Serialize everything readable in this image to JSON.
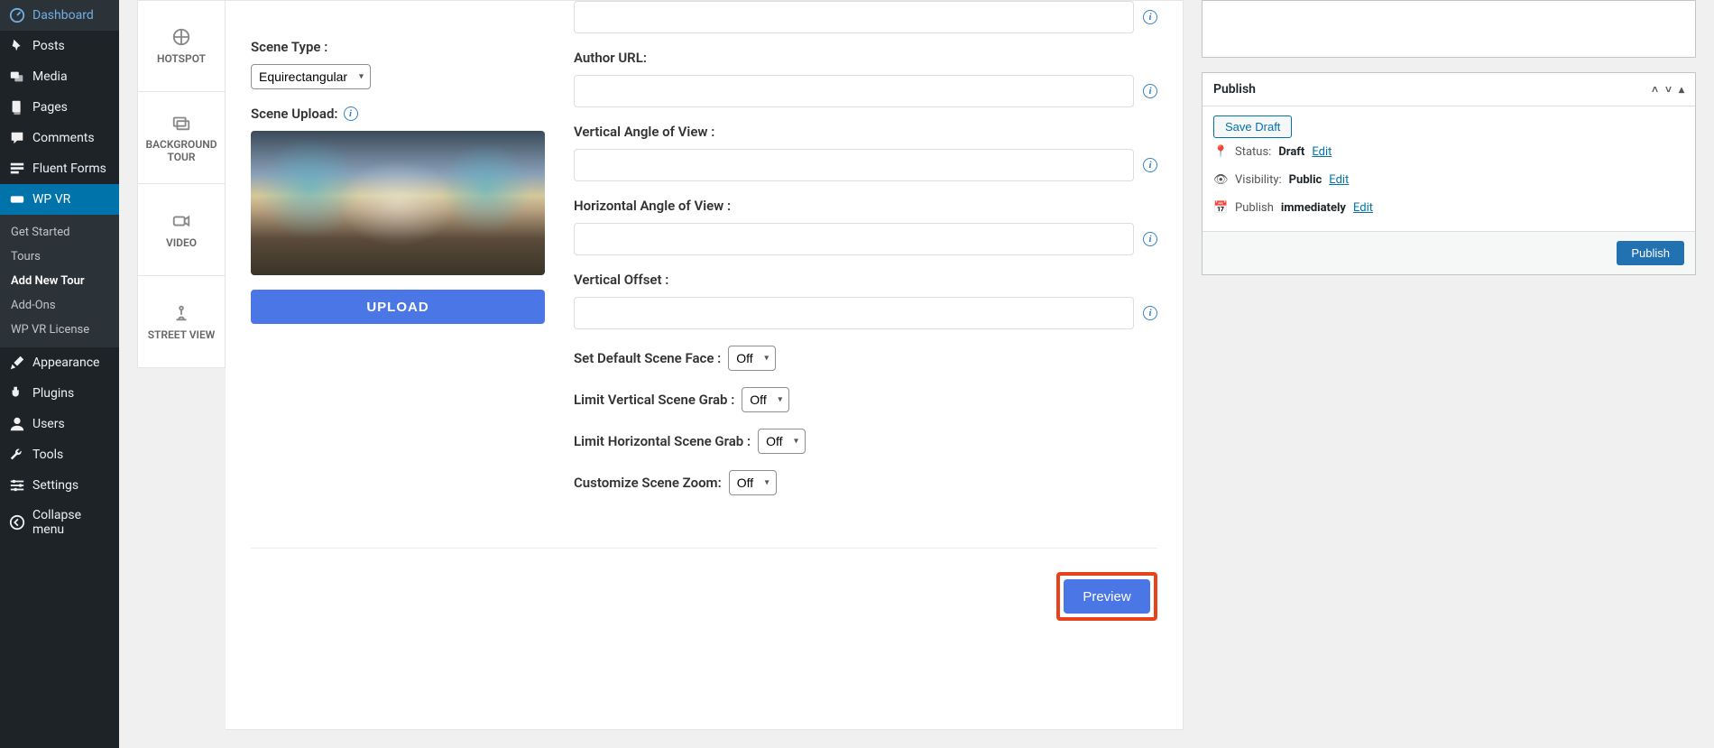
{
  "sidebar": {
    "items": [
      {
        "label": "Dashboard"
      },
      {
        "label": "Posts"
      },
      {
        "label": "Media"
      },
      {
        "label": "Pages"
      },
      {
        "label": "Comments"
      },
      {
        "label": "Fluent Forms"
      },
      {
        "label": "WP VR"
      },
      {
        "label": "Appearance"
      },
      {
        "label": "Plugins"
      },
      {
        "label": "Users"
      },
      {
        "label": "Tools"
      },
      {
        "label": "Settings"
      },
      {
        "label": "Collapse menu"
      }
    ],
    "sub": [
      {
        "label": "Get Started"
      },
      {
        "label": "Tours"
      },
      {
        "label": "Add New Tour"
      },
      {
        "label": "Add-Ons"
      },
      {
        "label": "WP VR License"
      }
    ]
  },
  "vtabs": [
    {
      "label": "HOTSPOT"
    },
    {
      "label": "BACKGROUND TOUR"
    },
    {
      "label": "VIDEO"
    },
    {
      "label": "STREET VIEW"
    }
  ],
  "form": {
    "scene_type_label": "Scene Type :",
    "scene_type_value": "Equirectangular",
    "scene_upload_label": "Scene Upload:",
    "upload_btn": "UPLOAD",
    "author_url_label": "Author URL:",
    "v_angle_label": "Vertical Angle of View :",
    "h_angle_label": "Horizontal Angle of View :",
    "v_offset_label": "Vertical Offset :",
    "default_face_label": "Set Default Scene Face :",
    "default_face_value": "Off",
    "limit_v_label": "Limit Vertical Scene Grab :",
    "limit_v_value": "Off",
    "limit_h_label": "Limit Horizontal Scene Grab :",
    "limit_h_value": "Off",
    "zoom_label": "Customize Scene Zoom:",
    "zoom_value": "Off",
    "preview_btn": "Preview"
  },
  "publish": {
    "title": "Publish",
    "save_draft": "Save Draft",
    "status_label": "Status:",
    "status_value": "Draft",
    "edit": "Edit",
    "visibility_label": "Visibility:",
    "visibility_value": "Public",
    "publish_label": "Publish",
    "publish_value": "immediately",
    "publish_btn": "Publish"
  }
}
